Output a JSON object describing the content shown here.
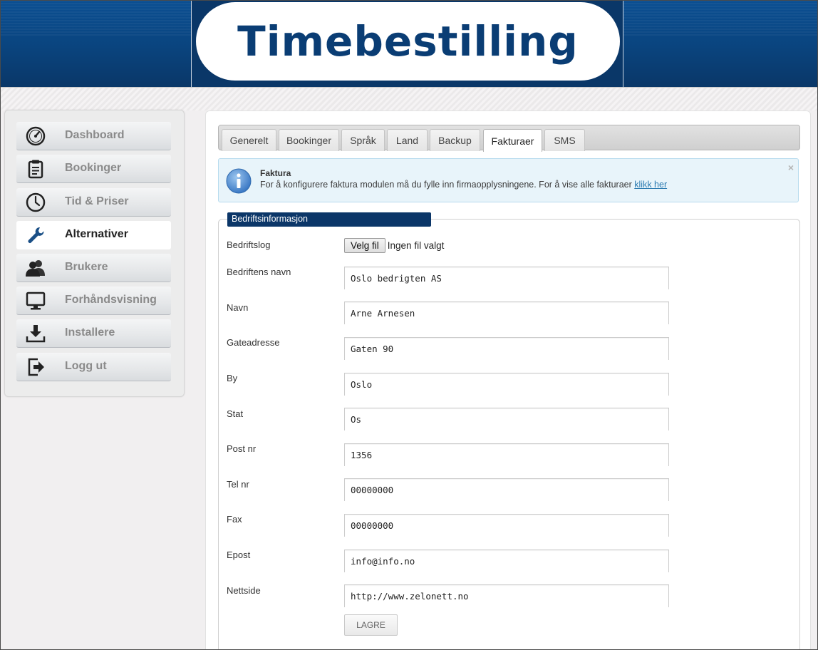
{
  "header": {
    "logo_text": "Timebestilling"
  },
  "sidebar": {
    "items": [
      {
        "label": "Dashboard",
        "icon": "speedometer-icon"
      },
      {
        "label": "Bookinger",
        "icon": "clipboard-icon"
      },
      {
        "label": "Tid & Priser",
        "icon": "clock-icon"
      },
      {
        "label": "Alternativer",
        "icon": "wrench-icon",
        "active": true
      },
      {
        "label": "Brukere",
        "icon": "users-icon"
      },
      {
        "label": "Forhåndsvisning",
        "icon": "monitor-icon"
      },
      {
        "label": "Installere",
        "icon": "download-icon"
      },
      {
        "label": "Logg ut",
        "icon": "logout-icon"
      }
    ]
  },
  "tabs": [
    {
      "label": "Generelt"
    },
    {
      "label": "Bookinger"
    },
    {
      "label": "Språk"
    },
    {
      "label": "Land"
    },
    {
      "label": "Backup"
    },
    {
      "label": "Fakturaer",
      "active": true
    },
    {
      "label": "SMS"
    }
  ],
  "alert": {
    "title": "Faktura",
    "text": "For å konfigurere faktura modulen må du fylle inn firmaopplysningene. For å vise alle fakturaer ",
    "link": "klikk her",
    "close": "×",
    "icon": "info-icon"
  },
  "form": {
    "legend": "Bedriftsinformasjon",
    "logo_label": "Bedriftslog",
    "file_button": "Velg fil",
    "file_status": "Ingen fil valgt",
    "fields": [
      {
        "label": "Bedriftens navn",
        "value": "Oslo bedrigten AS"
      },
      {
        "label": "Navn",
        "value": "Arne Arnesen"
      },
      {
        "label": "Gateadresse",
        "value": "Gaten 90"
      },
      {
        "label": "By",
        "value": "Oslo"
      },
      {
        "label": "Stat",
        "value": "Os"
      },
      {
        "label": "Post nr",
        "value": "1356"
      },
      {
        "label": "Tel nr",
        "value": "00000000"
      },
      {
        "label": "Fax",
        "value": "00000000"
      },
      {
        "label": "Epost",
        "value": "info@info.no"
      },
      {
        "label": "Nettside",
        "value": "http://www.zelonett.no"
      }
    ],
    "save_label": "LAGRE"
  },
  "colors": {
    "header_blue": "#0a4580",
    "legend_blue": "#0b3668",
    "link_blue": "#2a7ab0",
    "alert_bg": "#e8f4fa"
  }
}
